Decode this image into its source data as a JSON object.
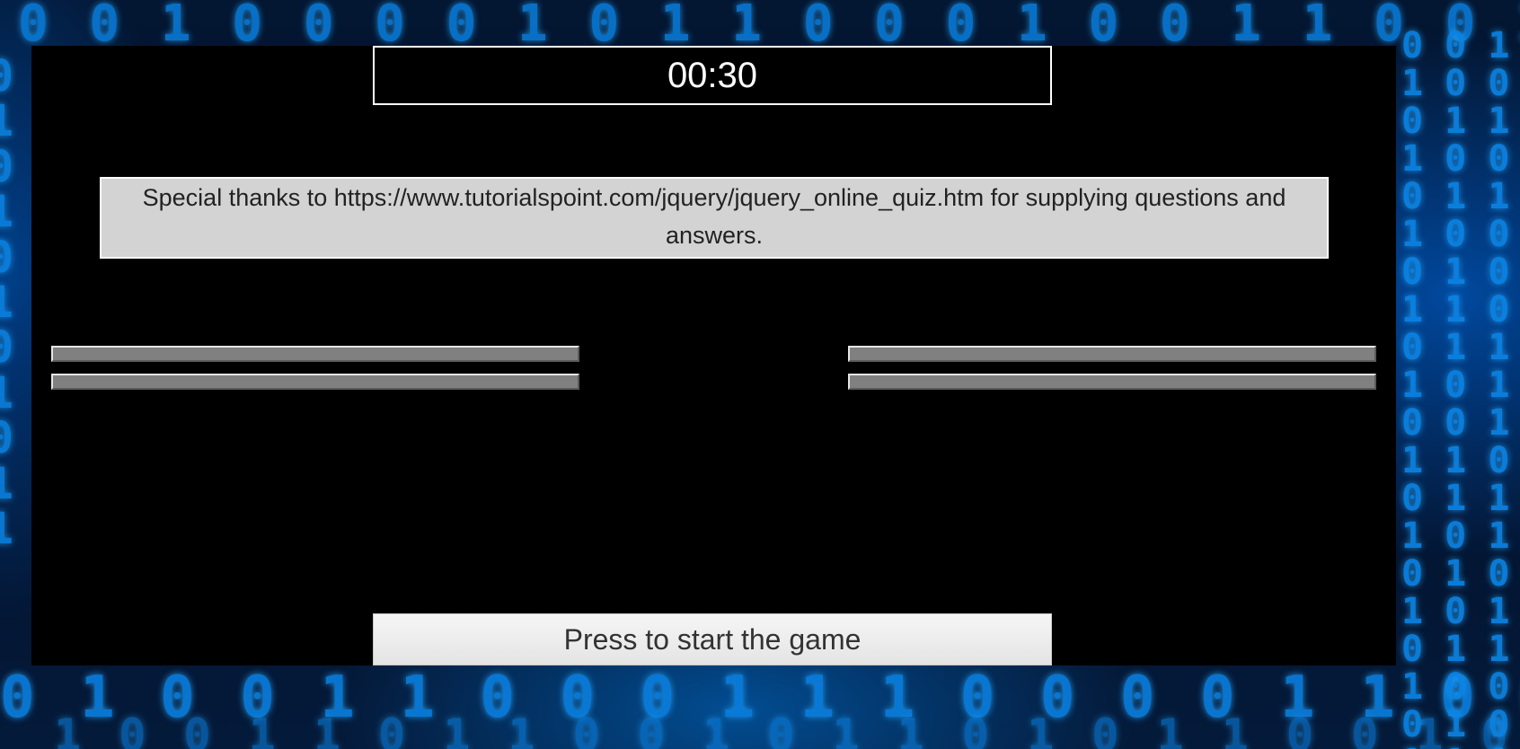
{
  "timer": {
    "value": "00:30"
  },
  "credits": {
    "text": "Special thanks to https://www.tutorialspoint.com/jquery/jquery_online_quiz.htm for supplying questions and answers."
  },
  "answers": [
    {
      "label": ""
    },
    {
      "label": ""
    },
    {
      "label": ""
    },
    {
      "label": ""
    }
  ],
  "start_button": {
    "label": "Press to start the game"
  },
  "colors": {
    "panel_background": "#000000",
    "credits_background": "#d3d3d3",
    "answer_button": "#808080",
    "wallpaper_digits": "#0a7fe0"
  }
}
